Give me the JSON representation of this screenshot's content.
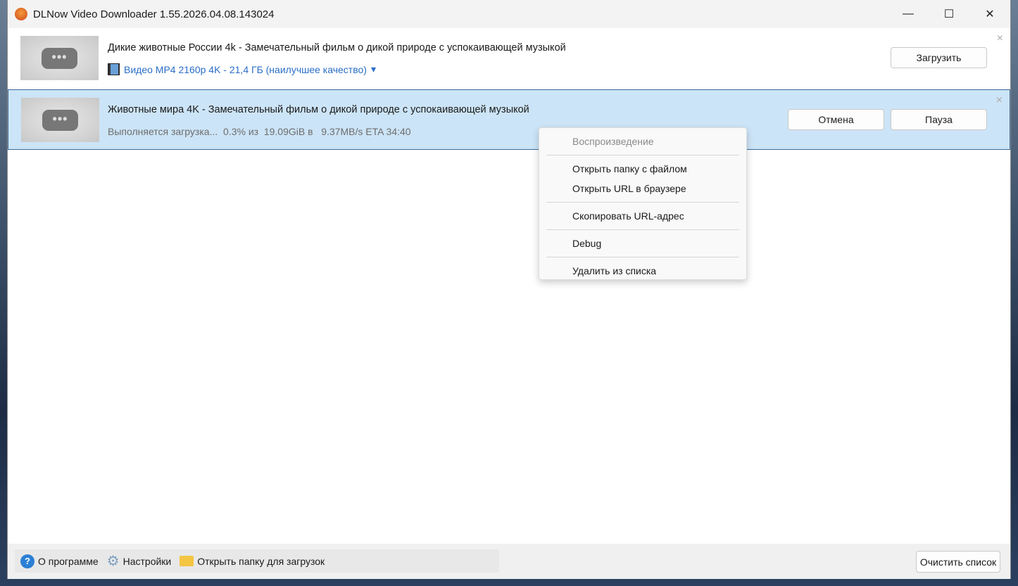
{
  "window": {
    "title": "DLNow Video Downloader 1.55.2026.04.08.143024",
    "minimize": "—",
    "maximize": "☐",
    "close": "✕"
  },
  "items": [
    {
      "title": "Дикие животные России 4k - Замечательный фильм о дикой природе с успокаивающей музыкой",
      "format": "Видео MP4 2160p 4K - 21,4 ГБ (наилучшее качество)",
      "format_arrow": "▾",
      "download_label": "Загрузить",
      "remove": "×"
    },
    {
      "title": "Животные мира 4K - Замечательный фильм о дикой природе с успокаивающей музыкой",
      "progress": "Выполняется загрузка...  0.3% из  19.09GiB в   9.37MB/s ETA 34:40",
      "progress_percent": 0.3,
      "cancel_label": "Отмена",
      "pause_label": "Пауза",
      "remove": "×"
    }
  ],
  "context_menu": [
    "Воспроизведение",
    "Открыть папку с файлом",
    "Открыть URL в браузере",
    "Скопировать URL-адрес",
    "Debug",
    "Удалить из списка"
  ],
  "toolbar": {
    "about": "О программе",
    "settings": "Настройки",
    "open_folder": "Открыть папку для загрузок",
    "clear": "Очистить список",
    "help_glyph": "?",
    "gear_glyph": "⚙"
  },
  "thumb_glyph": "•••"
}
